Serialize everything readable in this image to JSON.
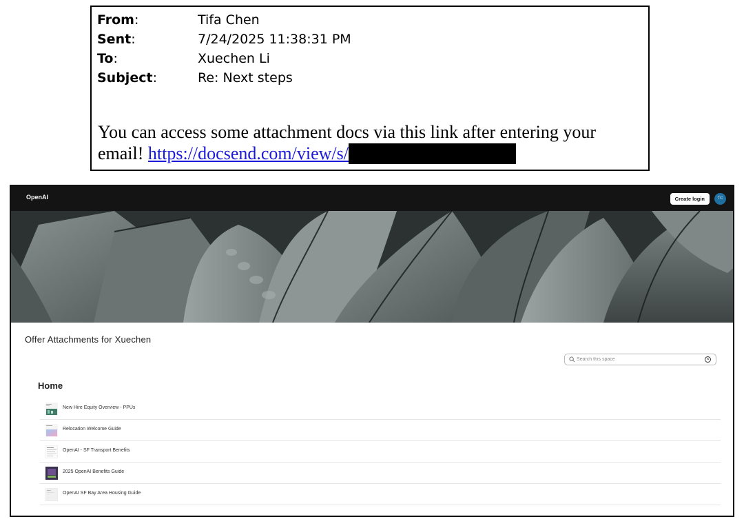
{
  "email": {
    "from_label": "From",
    "from_value": "Tifa Chen",
    "sent_label": "Sent",
    "sent_value": "7/24/2025 11:38:31 PM",
    "to_label": "To",
    "to_value": "Xuechen Li",
    "subject_label": "Subject",
    "subject_value": "Re: Next steps",
    "body_text": "You can access some attachment docs via this link after entering your email!",
    "link_text": "https://docsend.com/view/s/"
  },
  "app": {
    "brand": "OpenAI",
    "create_login_label": "Create login",
    "avatar_initials": "TC",
    "accent_color": "#1f6fa0"
  },
  "space": {
    "title": "Offer Attachments for Xuechen",
    "search_placeholder": "Search this space",
    "section_heading": "Home",
    "documents": [
      {
        "title": "New Hire Equity Overview - PPUs",
        "thumb": "green-chart-thumbnail"
      },
      {
        "title": "Relocation Welcome Guide",
        "thumb": "gradient-thumbnail"
      },
      {
        "title": "OpenAI - SF Transport Benefits",
        "thumb": "text-page-thumbnail"
      },
      {
        "title": "2025 OpenAI Benefits Guide",
        "thumb": "purple-cover-thumbnail"
      },
      {
        "title": "OpenAI SF Bay Area Housing Guide",
        "thumb": "plain-page-thumbnail"
      }
    ]
  }
}
